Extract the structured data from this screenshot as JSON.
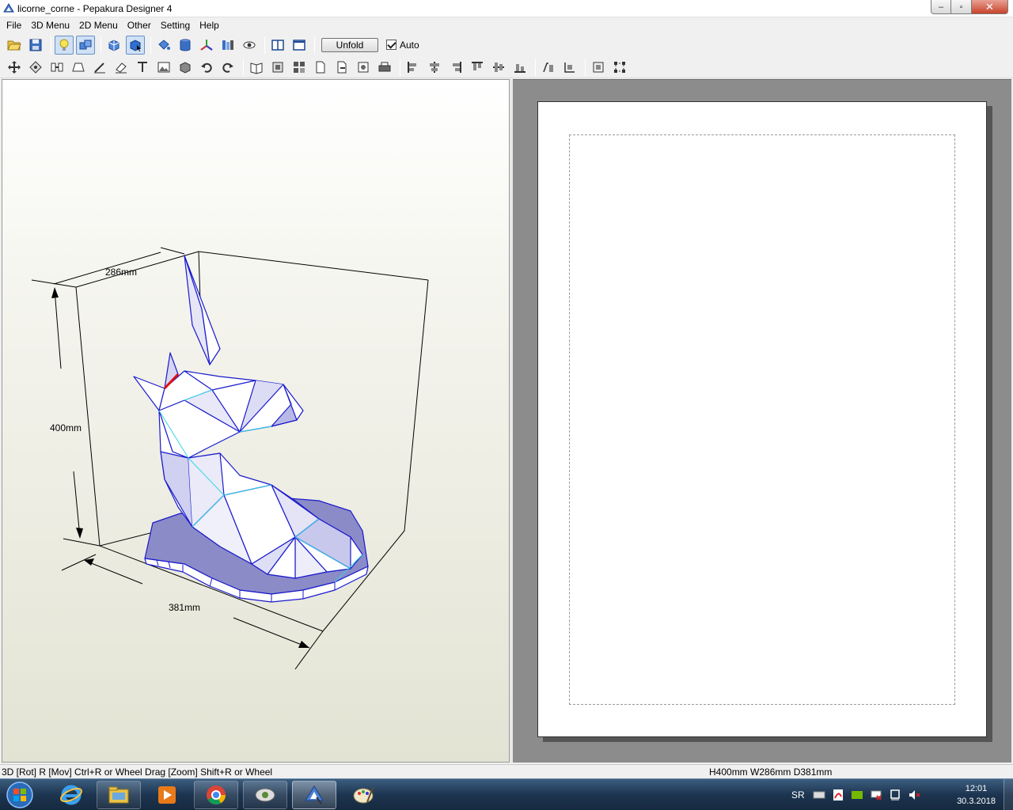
{
  "window": {
    "title": "licorne_corne - Pepakura Designer 4",
    "minimize": "–",
    "maximize": "▫",
    "close": "✕"
  },
  "menu": [
    "File",
    "3D Menu",
    "2D Menu",
    "Other",
    "Setting",
    "Help"
  ],
  "toolbar1": {
    "unfold_label": "Unfold",
    "auto_label": "Auto",
    "auto_checked": true
  },
  "view3d": {
    "dim_width": "286mm",
    "dim_height": "400mm",
    "dim_depth": "381mm",
    "model_fill": "#ffffff",
    "model_shade": "#8b8bc8",
    "edge_color": "#1a1acc",
    "fold_color": "#33d6e6",
    "highlight_edge": "#e01010"
  },
  "status": {
    "left": "3D [Rot] R [Mov] Ctrl+R or Wheel Drag [Zoom] Shift+R or Wheel",
    "right": "H400mm W286mm D381mm"
  },
  "taskbar": {
    "lang": "SR",
    "time": "12:01",
    "date": "30.3.2018"
  }
}
